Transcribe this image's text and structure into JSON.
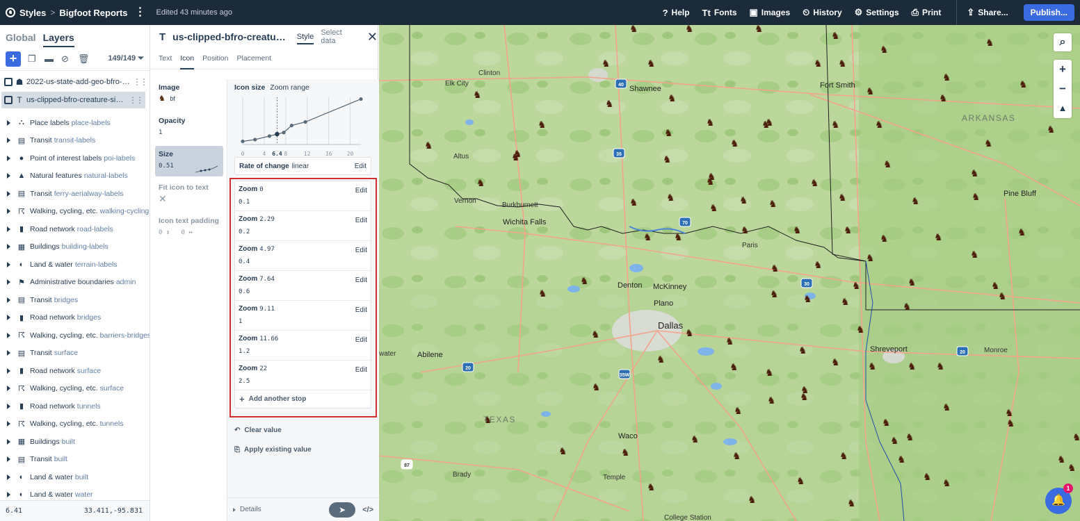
{
  "topbar": {
    "styles": "Styles",
    "sep": ">",
    "project": "Bigfoot Reports",
    "more": "⋮",
    "edited": "Edited 43 minutes ago",
    "items": [
      {
        "icon": "help-icon",
        "glyph": "?",
        "label": "Help"
      },
      {
        "icon": "fonts-icon",
        "glyph": "Tt",
        "label": "Fonts"
      },
      {
        "icon": "images-icon",
        "glyph": "▣",
        "label": "Images"
      },
      {
        "icon": "history-icon",
        "glyph": "⏲",
        "label": "History"
      },
      {
        "icon": "settings-icon",
        "glyph": "⚙",
        "label": "Settings"
      },
      {
        "icon": "print-icon",
        "glyph": "⎙",
        "label": "Print"
      }
    ],
    "share": "Share...",
    "publish": "Publish..."
  },
  "left": {
    "tab_global": "Global",
    "tab_layers": "Layers",
    "count": "149/149",
    "top_layers": [
      {
        "name": "2022-us-state-add-geo-bfro-0ssppu"
      },
      {
        "name": "us-clipped-bfro-creature-sign-duz..."
      }
    ],
    "groups": [
      {
        "icon": "place-icon",
        "glyph": "⛬",
        "name": "Place labels",
        "sub": "place-labels"
      },
      {
        "icon": "transit-icon",
        "glyph": "▤",
        "name": "Transit",
        "sub": "transit-labels"
      },
      {
        "icon": "poi-icon",
        "glyph": "●",
        "name": "Point of interest labels",
        "sub": "poi-labels"
      },
      {
        "icon": "natural-icon",
        "glyph": "▲",
        "name": "Natural features",
        "sub": "natural-labels"
      },
      {
        "icon": "transit-icon",
        "glyph": "▤",
        "name": "Transit",
        "sub": "ferry-aerialway-labels"
      },
      {
        "icon": "walking-icon",
        "glyph": "☈",
        "name": "Walking, cycling, etc.",
        "sub": "walking-cycling-labels"
      },
      {
        "icon": "road-icon",
        "glyph": "▮",
        "name": "Road network",
        "sub": "road-labels"
      },
      {
        "icon": "buildings-icon",
        "glyph": "▦",
        "name": "Buildings",
        "sub": "building-labels"
      },
      {
        "icon": "land-water-icon",
        "glyph": "◐",
        "name": "Land & water",
        "sub": "terrain-labels"
      },
      {
        "icon": "admin-icon",
        "glyph": "⚑",
        "name": "Administrative boundaries",
        "sub": "admin"
      },
      {
        "icon": "transit-icon",
        "glyph": "▤",
        "name": "Transit",
        "sub": "bridges"
      },
      {
        "icon": "road-icon",
        "glyph": "▮",
        "name": "Road network",
        "sub": "bridges"
      },
      {
        "icon": "walking-icon",
        "glyph": "☈",
        "name": "Walking, cycling, etc.",
        "sub": "barriers-bridges"
      },
      {
        "icon": "transit-icon",
        "glyph": "▤",
        "name": "Transit",
        "sub": "surface"
      },
      {
        "icon": "road-icon",
        "glyph": "▮",
        "name": "Road network",
        "sub": "surface"
      },
      {
        "icon": "walking-icon",
        "glyph": "☈",
        "name": "Walking, cycling, etc.",
        "sub": "surface"
      },
      {
        "icon": "road-icon",
        "glyph": "▮",
        "name": "Road network",
        "sub": "tunnels"
      },
      {
        "icon": "walking-icon",
        "glyph": "☈",
        "name": "Walking, cycling, etc.",
        "sub": "tunnels"
      },
      {
        "icon": "buildings-icon",
        "glyph": "▦",
        "name": "Buildings",
        "sub": "built"
      },
      {
        "icon": "transit-icon",
        "glyph": "▤",
        "name": "Transit",
        "sub": "built"
      },
      {
        "icon": "land-water-icon",
        "glyph": "◐",
        "name": "Land & water",
        "sub": "built"
      },
      {
        "icon": "land-water-icon",
        "glyph": "◐",
        "name": "Land & water",
        "sub": "water"
      }
    ],
    "footer_zoom": "6.41",
    "footer_coords": "33.411,-95.831"
  },
  "mid": {
    "title": "us-clipped-bfro-creature-...",
    "tab_style": "Style",
    "tab_select": "Select data",
    "subtabs": [
      "Text",
      "Icon",
      "Position",
      "Placement"
    ],
    "props": {
      "image_label": "Image",
      "image_value": "bf",
      "opacity_label": "Opacity",
      "opacity_value": "1",
      "size_label": "Size",
      "size_value": "0.51",
      "fit_label": "Fit icon to text",
      "padding_label": "Icon text padding",
      "padding_v": "0",
      "padding_h": "0"
    },
    "editor": {
      "title": "Icon size",
      "range": "Zoom range",
      "ticks": [
        "0",
        "4",
        "8",
        "12",
        "16",
        "20"
      ],
      "current_zoom": "6.4",
      "rate_label": "Rate of change",
      "rate_value": "linear",
      "edit": "Edit",
      "zoom_word": "Zoom",
      "stops": [
        {
          "zoom": "0",
          "value": "0.1"
        },
        {
          "zoom": "2.29",
          "value": "0.2"
        },
        {
          "zoom": "4.97",
          "value": "0.4"
        },
        {
          "zoom": "7.64",
          "value": "0.6"
        },
        {
          "zoom": "9.11",
          "value": "1"
        },
        {
          "zoom": "11.66",
          "value": "1.2"
        },
        {
          "zoom": "22",
          "value": "2.5"
        }
      ],
      "add_stop": "Add another stop",
      "clear": "Clear value",
      "apply": "Apply existing value",
      "details": "Details",
      "code": "</>"
    }
  },
  "map": {
    "cities": [
      {
        "n": "Clinton"
      },
      {
        "n": "Elk City"
      },
      {
        "n": "Shawnee"
      },
      {
        "n": "Fort Smith"
      },
      {
        "n": "ARKANSAS"
      },
      {
        "n": "Altus"
      },
      {
        "n": "Vernon"
      },
      {
        "n": "Burkburnett"
      },
      {
        "n": "Wichita Falls"
      },
      {
        "n": "Paris"
      },
      {
        "n": "Pine Bluff"
      },
      {
        "n": "Denton"
      },
      {
        "n": "McKinney"
      },
      {
        "n": "Plano"
      },
      {
        "n": "Dallas"
      },
      {
        "n": "Abilene"
      },
      {
        "n": "Shreveport"
      },
      {
        "n": "Monroe"
      },
      {
        "n": "TEXAS"
      },
      {
        "n": "Waco"
      },
      {
        "n": "Brady"
      },
      {
        "n": "Temple"
      },
      {
        "n": "College Station"
      },
      {
        "n": "water"
      }
    ],
    "shields": [
      "40",
      "35",
      "70",
      "30",
      "20",
      "35W",
      "20",
      "87"
    ],
    "notifications": "1"
  }
}
